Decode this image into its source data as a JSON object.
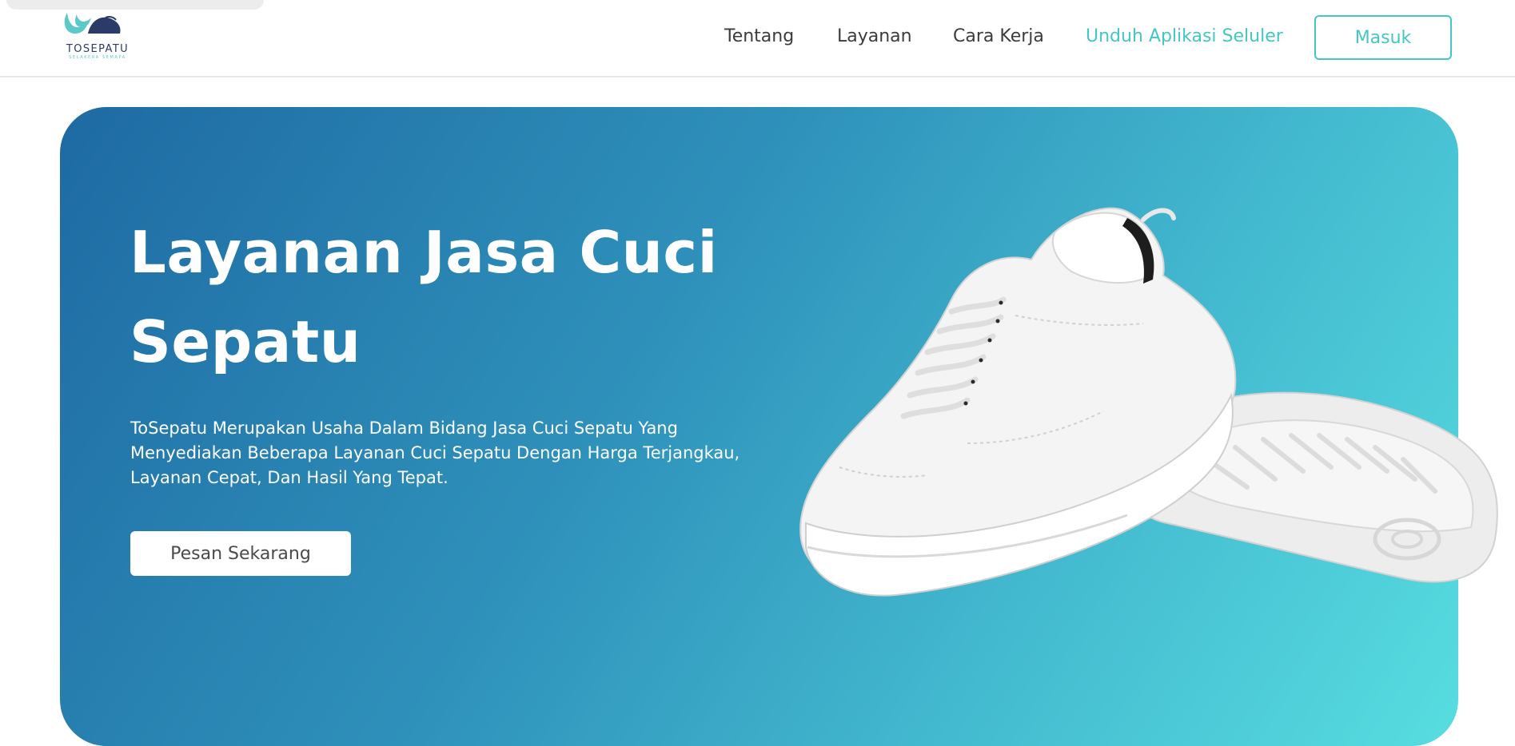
{
  "brand": {
    "name": "TOSEPATU",
    "tagline": "SELAKERA SEMAPA"
  },
  "nav": {
    "items": [
      {
        "label": "Tentang"
      },
      {
        "label": "Layanan"
      },
      {
        "label": "Cara Kerja"
      },
      {
        "label": "Unduh Aplikasi Seluler"
      }
    ],
    "login_label": "Masuk"
  },
  "hero": {
    "title_line1": "Layanan Jasa Cuci",
    "title_line2": "Sepatu",
    "description": "ToSepatu Merupakan Usaha Dalam Bidang Jasa Cuci Sepatu Yang Menyediakan Beberapa Layanan Cuci Sepatu Dengan Harga Terjangkau, Layanan Cepat, Dan Hasil Yang Tepat.",
    "cta_label": "Pesan Sekarang"
  },
  "colors": {
    "accent": "#45c6c6",
    "hero_start": "#1e6aa3",
    "hero_end": "#57dde0",
    "logo_navy": "#2b3a67"
  }
}
